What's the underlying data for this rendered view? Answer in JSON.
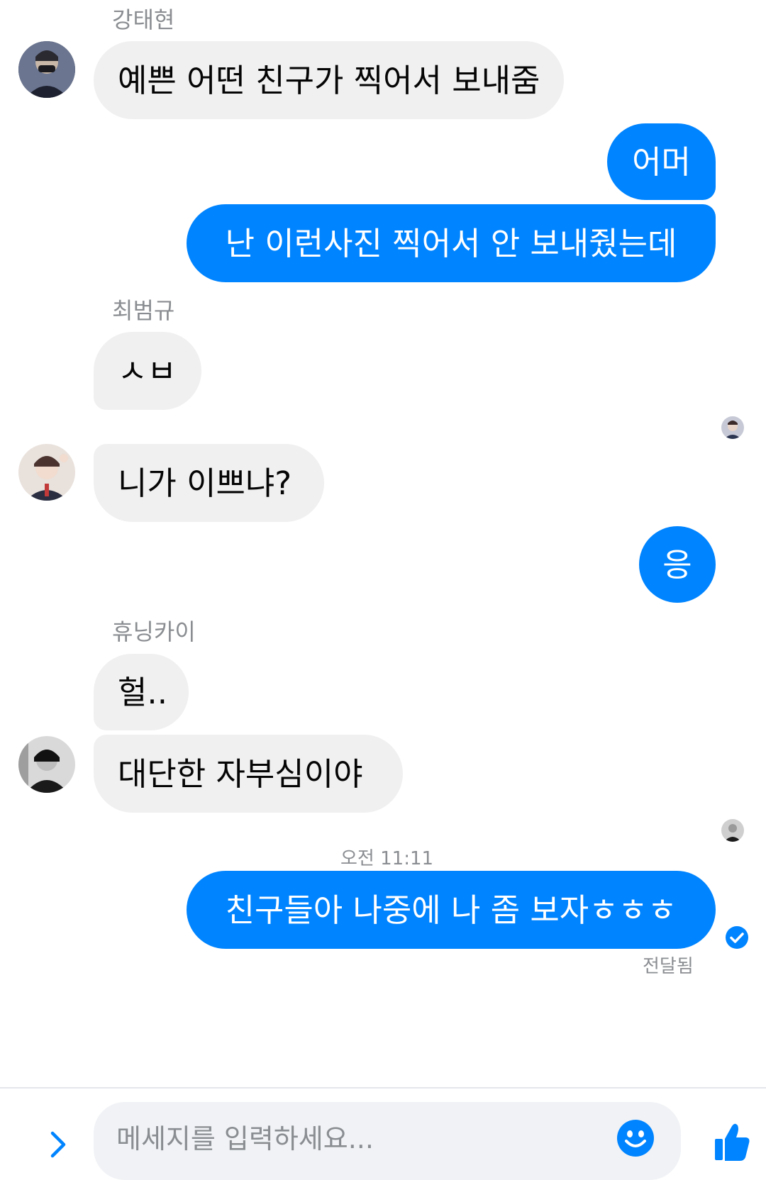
{
  "colors": {
    "accent": "#0084ff",
    "incoming_bubble": "#f0f0f0",
    "meta_text": "#8a8d91"
  },
  "messages": [
    {
      "sender": "강태현",
      "text": "예쁜 어떤 친구가 찍어서 보내줌"
    },
    {
      "text": "어머"
    },
    {
      "text": "난 이런사진 찍어서 안 보내줬는데"
    },
    {
      "sender": "최범규",
      "text": "ㅅㅂ"
    },
    {
      "text": "니가 이쁘냐?"
    },
    {
      "text": "응"
    },
    {
      "sender": "휴닝카이",
      "text": "헐.."
    },
    {
      "text": "대단한 자부심이야"
    },
    {
      "timestamp": "오전 11:11",
      "text": "친구들아 나중에 나 좀 보자ㅎㅎㅎ",
      "status": "전달됨"
    }
  ],
  "composer": {
    "placeholder": "메세지를 입력하세요...",
    "expand_icon": "chevron-right-icon",
    "emoji_icon": "emoji-smile-icon",
    "like_icon": "thumbs-up-icon"
  }
}
